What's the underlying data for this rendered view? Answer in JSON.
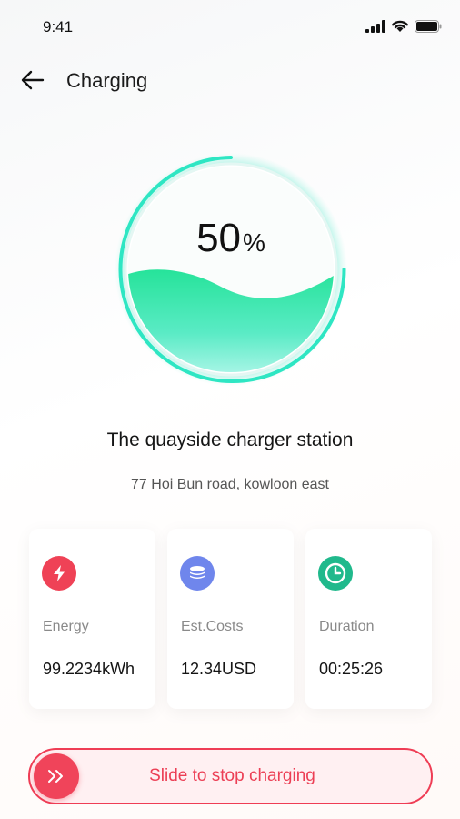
{
  "status_bar": {
    "time": "9:41"
  },
  "header": {
    "title": "Charging"
  },
  "gauge": {
    "percent_value": "50",
    "percent_symbol": "%",
    "level": 0.5
  },
  "station": {
    "name": "The quayside charger station",
    "address": "77 Hoi Bun road, kowloon east"
  },
  "stats": [
    {
      "icon": "lightning-icon",
      "label": "Energy",
      "value": "99.2234kWh",
      "color": "#ef4256"
    },
    {
      "icon": "coins-icon",
      "label": "Est.Costs",
      "value": "12.34USD",
      "color": "#6f86ec"
    },
    {
      "icon": "clock-icon",
      "label": "Duration",
      "value": "00:25:26",
      "color": "#20b98c"
    }
  ],
  "stop_slider": {
    "label": "Slide to stop charging",
    "icon": "double-chevron-right-icon",
    "color": "#ef3d55"
  }
}
